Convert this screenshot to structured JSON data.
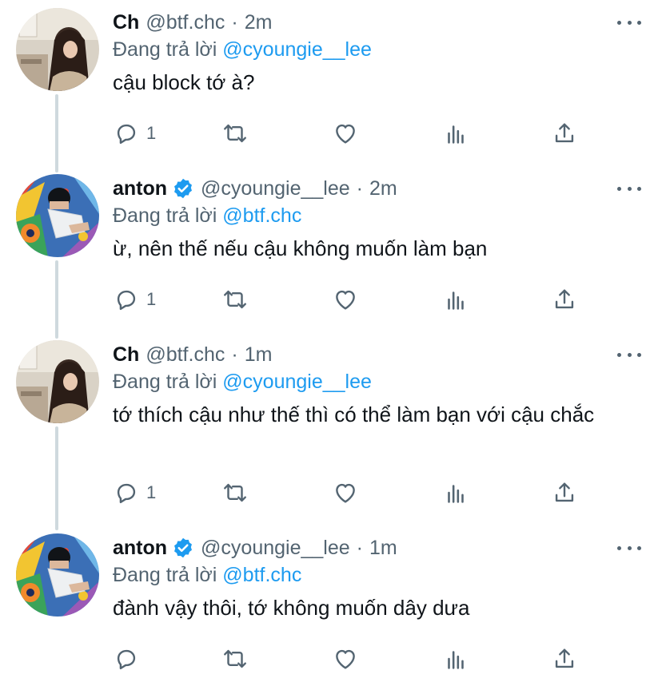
{
  "colors": {
    "accent": "#1d9bf0",
    "secondary_text": "#536471",
    "primary_text": "#0f1419",
    "thread_line": "#cfd9de"
  },
  "replying_prefix": "Đang trả lời",
  "tweets": [
    {
      "name": "Ch",
      "verified": false,
      "handle": "@btf.chc",
      "separator": "·",
      "time": "2m",
      "reply_to": "@cyoungie__lee",
      "text": "cậu block tớ à?",
      "reply_count": "1",
      "avatar": "avatar-girl-icon"
    },
    {
      "name": "anton",
      "verified": true,
      "handle": "@cyoungie__lee",
      "separator": "·",
      "time": "2m",
      "reply_to": "@btf.chc",
      "text": "ừ, nên thế nếu cậu không muốn làm bạn",
      "reply_count": "1",
      "avatar": "avatar-boy-mural-icon"
    },
    {
      "name": "Ch",
      "verified": false,
      "handle": "@btf.chc",
      "separator": "·",
      "time": "1m",
      "reply_to": "@cyoungie__lee",
      "text": "tớ thích cậu như thế thì có thể làm bạn với cậu chắc",
      "reply_count": "1",
      "avatar": "avatar-girl-icon"
    },
    {
      "name": "anton",
      "verified": true,
      "handle": "@cyoungie__lee",
      "separator": "·",
      "time": "1m",
      "reply_to": "@btf.chc",
      "text": "đành vậy thôi, tớ không muốn dây dưa",
      "reply_count": "",
      "avatar": "avatar-boy-mural-icon"
    }
  ]
}
